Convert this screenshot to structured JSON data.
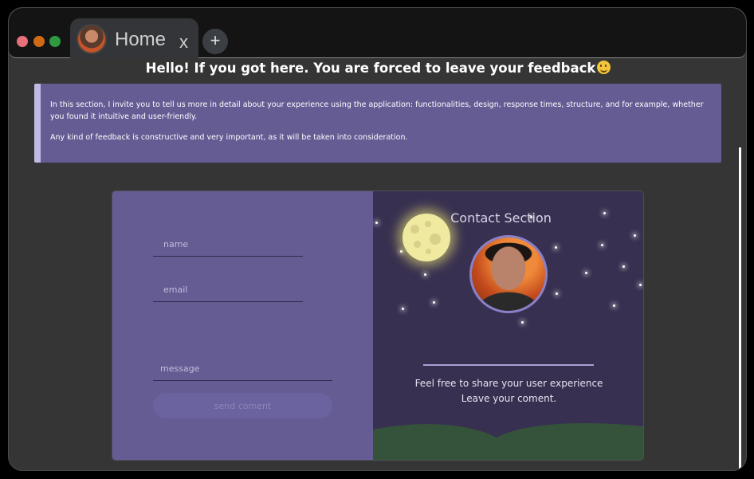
{
  "browser": {
    "tab_title": "Home",
    "tab_close": "x",
    "new_tab": "+"
  },
  "page": {
    "headline": "Hello! If you got here. You are forced to leave your feedback",
    "intro_p1": "In this section, I invite you to tell us more in detail about your experience using the application: functionalities, design, response times, structure, and for example, whether you found it intuitive and user-friendly.",
    "intro_p2": "Any kind of feedback is constructive and very important, as it will be taken into consideration."
  },
  "form": {
    "name_placeholder": "name",
    "email_placeholder": "email",
    "message_placeholder": "message",
    "send_label": "send coment"
  },
  "contact": {
    "title": "Contact Section",
    "line1": "Feel free to share your user experience",
    "line2": "Leave your coment."
  },
  "colors": {
    "form_bg": "#655c94",
    "contact_bg": "#383050",
    "hills": "#35533a",
    "moon": "#f0e9a0"
  }
}
